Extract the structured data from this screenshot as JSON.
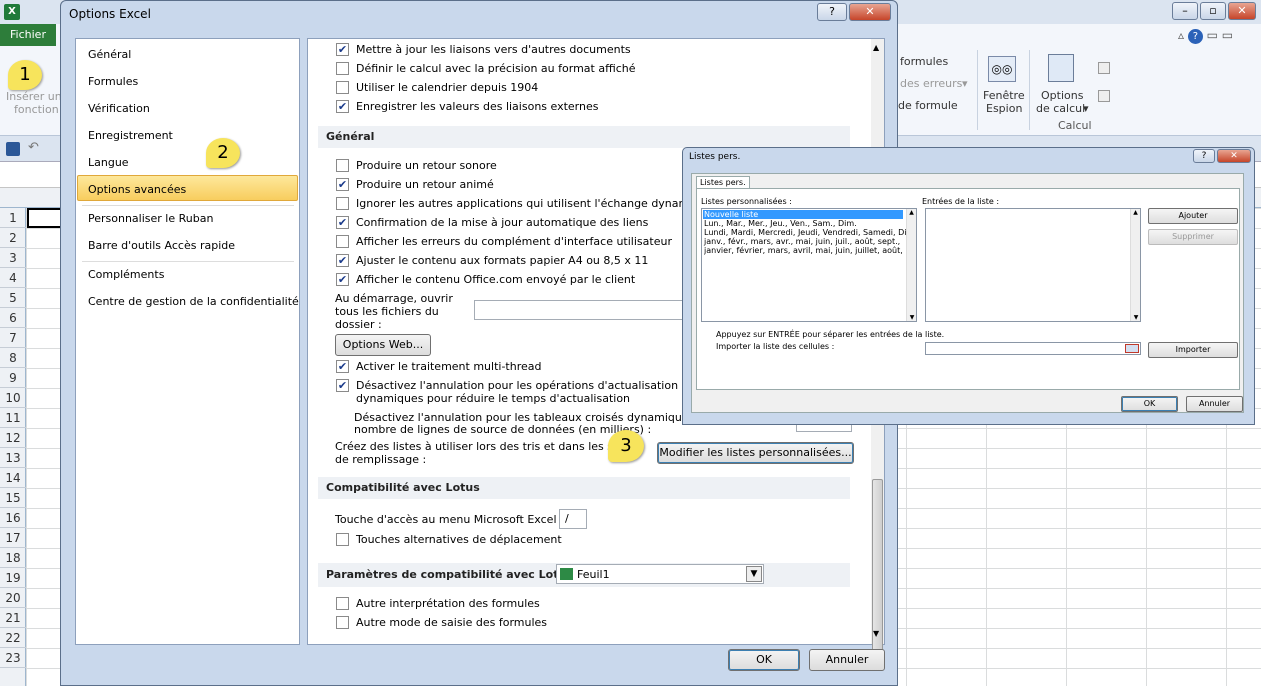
{
  "excel": {
    "file_tab": "Fichier",
    "ribbon": {
      "insert_function_line1": "Insérer un",
      "insert_function_line2": "fonction",
      "formulas": "formules",
      "errors": "des erreurs",
      "formula": "de formule",
      "watch_window_line1": "Fenêtre",
      "watch_window_line2": "Espion",
      "calc_options_line1": "Options",
      "calc_options_line2": "de calcul",
      "group_calc": "Calcul"
    },
    "row_numbers": [
      "1",
      "2",
      "3",
      "4",
      "5",
      "6",
      "7",
      "8",
      "9",
      "10",
      "11",
      "12",
      "13",
      "14",
      "15",
      "16",
      "17",
      "18",
      "19",
      "20",
      "21",
      "22",
      "23"
    ]
  },
  "callouts": [
    "1",
    "2",
    "3"
  ],
  "options_dialog": {
    "title": "Options Excel",
    "help_btn": "?",
    "close_btn": "✕",
    "nav": [
      "Général",
      "Formules",
      "Vérification",
      "Enregistrement",
      "Langue",
      "Options avancées",
      "Personnaliser le Ruban",
      "Barre d'outils Accès rapide",
      "Compléments",
      "Centre de gestion de la confidentialité"
    ],
    "top_checkboxes": [
      {
        "label": "Mettre à jour les liaisons vers d'autres documents",
        "checked": true
      },
      {
        "label": "Définir le calcul avec la précision au format affiché",
        "checked": false
      },
      {
        "label": "Utiliser le calendrier depuis 1904",
        "checked": false
      },
      {
        "label": "Enregistrer les valeurs des liaisons externes",
        "checked": true
      }
    ],
    "section_general": "Général",
    "general_checkboxes": [
      {
        "label": "Produire un retour sonore",
        "checked": false
      },
      {
        "label": "Produire un retour animé",
        "checked": true
      },
      {
        "label": "Ignorer les autres applications qui utilisent l'échange dynamique",
        "checked": false
      },
      {
        "label": "Confirmation de la mise à jour automatique des liens",
        "checked": true
      },
      {
        "label": "Afficher les erreurs du complément d'interface utilisateur",
        "checked": false
      },
      {
        "label": "Ajuster le contenu aux formats papier A4 ou 8,5 x 11",
        "checked": true
      },
      {
        "label": "Afficher le contenu Office.com envoyé par le client",
        "checked": true
      }
    ],
    "startup_line1": "Au démarrage, ouvrir",
    "startup_line2": "tous les fichiers du",
    "startup_line3": "dossier :",
    "web_options_btn": "Options Web...",
    "multithread": {
      "label": "Activer le traitement multi-thread",
      "checked": true
    },
    "undo_pivot_line1": "Désactivez l'annulation pour les opérations d'actualisation de g",
    "undo_pivot_line2": "dynamiques pour réduire le temps d'actualisation",
    "undo_pivot_checked": true,
    "undo_tables_line1": "Désactivez l'annulation pour les tableaux croisés dynamiques ave",
    "undo_tables_line2": "nombre de lignes de source de données (en milliers) :",
    "lists_line1": "Créez des listes à utiliser lors des tris et dans les séque",
    "lists_line2": "de remplissage :",
    "edit_lists_btn": "Modifier les listes personnalisées...",
    "section_lotus": "Compatibilité avec Lotus",
    "menu_key_label": "Touche d'accès au menu  Microsoft Excel :",
    "menu_key_value": "/",
    "nav_keys": {
      "label": "Touches alternatives de déplacement",
      "checked": false
    },
    "section_lotus_settings": "Paramètres de compatibilité avec Lotus :",
    "sheet_select": "Feuil1",
    "lotus_checkboxes": [
      {
        "label": "Autre interprétation des formules",
        "checked": false
      },
      {
        "label": "Autre mode de saisie des formules",
        "checked": false
      }
    ],
    "ok": "OK",
    "cancel": "Annuler"
  },
  "lists_dialog": {
    "title": "Listes pers.",
    "tab": "Listes pers.",
    "lists_label": "Listes personnalisées :",
    "entries_label": "Entrées de la liste :",
    "lists": [
      "Nouvelle liste",
      "Lun., Mar., Mer., Jeu., Ven., Sam., Dim.",
      "Lundi, Mardi, Mercredi, Jeudi, Vendredi, Samedi, Dim",
      "janv., févr., mars, avr., mai, juin, juil., août, sept.,",
      "janvier, février, mars, avril, mai, juin, juillet, août, se"
    ],
    "add_btn": "Ajouter",
    "delete_btn": "Supprimer",
    "hint": "Appuyez sur ENTRÉE pour séparer les entrées de la liste.",
    "import_label": "Importer la liste des cellules :",
    "import_btn": "Importer",
    "ok": "OK",
    "cancel": "Annuler"
  }
}
